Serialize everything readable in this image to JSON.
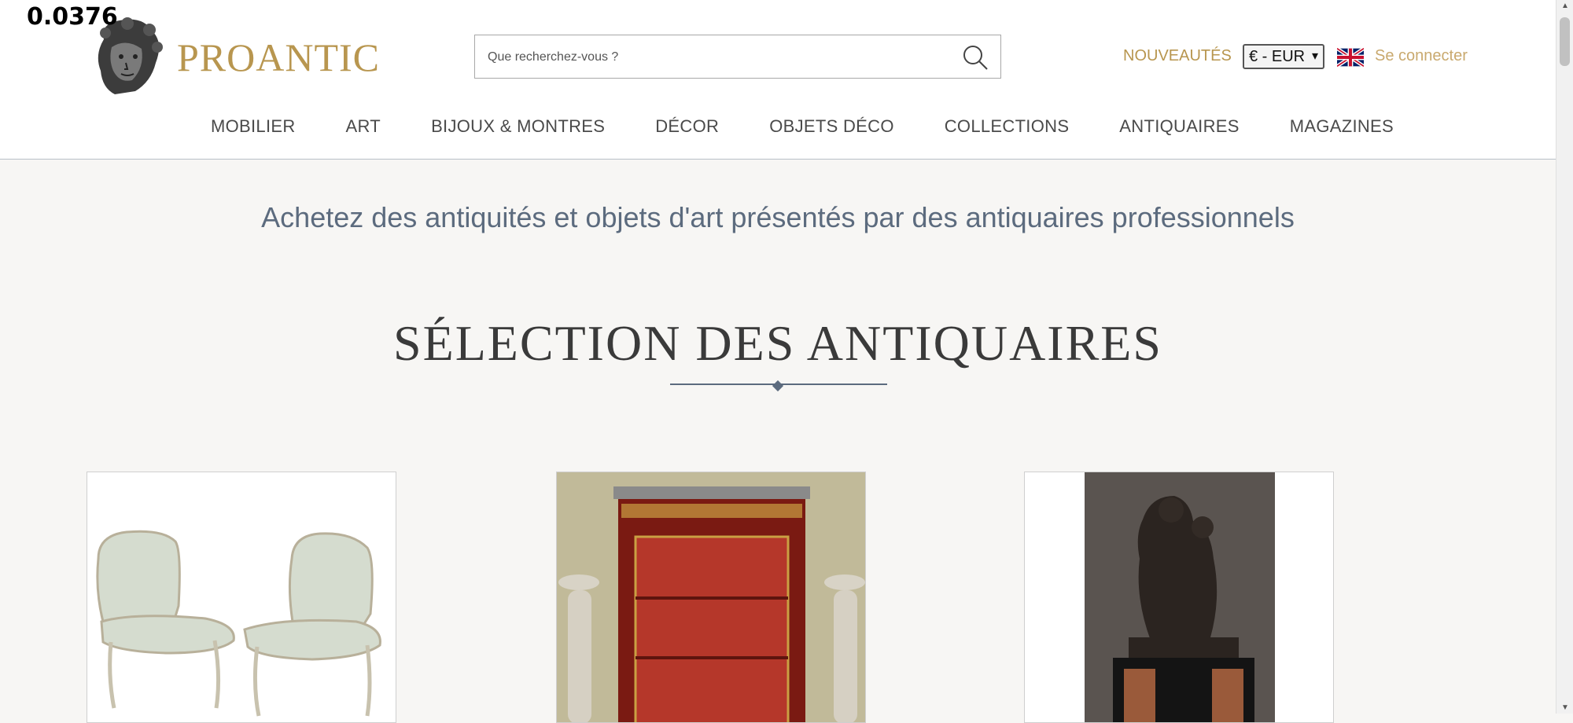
{
  "overlay_value": "0.0376",
  "brand": {
    "name": "PROANTIC"
  },
  "search": {
    "placeholder": "Que recherchez-vous ?"
  },
  "header_links": {
    "new": "NOUVEAUTÉS",
    "currency": "€ - EUR",
    "login": "Se connecter"
  },
  "nav": [
    "MOBILIER",
    "ART",
    "BIJOUX & MONTRES",
    "DÉCOR",
    "OBJETS DÉCO",
    "COLLECTIONS",
    "ANTIQUAIRES",
    "MAGAZINES"
  ],
  "tagline": "Achetez des antiquités et objets d'art présentés par des antiquaires professionnels",
  "section": {
    "title": "SÉLECTION DES ANTIQUAIRES"
  },
  "colors": {
    "gold": "#b8964f",
    "slate": "#5c6b7e",
    "background": "#f7f6f4"
  }
}
